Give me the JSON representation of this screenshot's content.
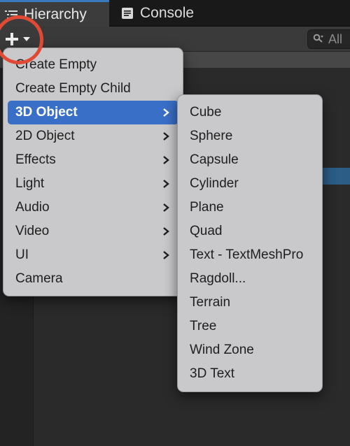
{
  "tabs": [
    {
      "label": "Hierarchy",
      "icon": "list-icon"
    },
    {
      "label": "Console",
      "icon": "console-icon"
    }
  ],
  "toolbar": {
    "add_icon": "plus-icon",
    "dropdown_icon": "caret-down-icon",
    "search_placeholder": "All",
    "search_icon": "search-icon"
  },
  "colors": {
    "accent": "#3a6fc7",
    "active_tab_border": "#3a79bf",
    "highlight_circle": "#e04a34",
    "menu_background": "#c9c9cc"
  },
  "create_menu": {
    "items": [
      {
        "label": "Create Empty",
        "has_submenu": false
      },
      {
        "label": "Create Empty Child",
        "has_submenu": false
      },
      {
        "label": "3D Object",
        "has_submenu": true,
        "active": true
      },
      {
        "label": "2D Object",
        "has_submenu": true
      },
      {
        "label": "Effects",
        "has_submenu": true
      },
      {
        "label": "Light",
        "has_submenu": true
      },
      {
        "label": "Audio",
        "has_submenu": true
      },
      {
        "label": "Video",
        "has_submenu": true
      },
      {
        "label": "UI",
        "has_submenu": true
      },
      {
        "label": "Camera",
        "has_submenu": false
      }
    ]
  },
  "submenu_3d": {
    "items": [
      {
        "label": "Cube"
      },
      {
        "label": "Sphere"
      },
      {
        "label": "Capsule"
      },
      {
        "label": "Cylinder"
      },
      {
        "label": "Plane"
      },
      {
        "label": "Quad"
      },
      {
        "label": "Text - TextMeshPro"
      },
      {
        "label": "Ragdoll..."
      },
      {
        "label": "Terrain"
      },
      {
        "label": "Tree"
      },
      {
        "label": "Wind Zone"
      },
      {
        "label": "3D Text"
      }
    ]
  }
}
